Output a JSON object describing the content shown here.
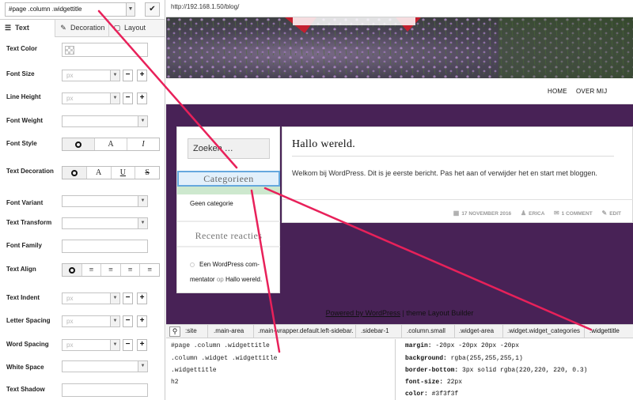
{
  "selector": {
    "value": "#page .column .widgettitle",
    "confirm": "✔"
  },
  "tabs": {
    "text": "Text",
    "decoration": "Decoration",
    "layout": "Layout"
  },
  "props": {
    "text_color": "Text Color",
    "font_size": "Font Size",
    "line_height": "Line Height",
    "font_weight": "Font Weight",
    "font_style": "Font Style",
    "text_decoration": "Text Decoration",
    "font_variant": "Font Variant",
    "text_transform": "Text Transform",
    "font_family": "Font Family",
    "text_align": "Text Align",
    "text_indent": "Text Indent",
    "letter_spacing": "Letter Spacing",
    "word_spacing": "Word Spacing",
    "white_space": "White Space",
    "text_shadow": "Text Shadow"
  },
  "unit_placeholder": "px",
  "stepper": {
    "minus": "−",
    "plus": "+"
  },
  "font_style_options": [
    "A",
    "I"
  ],
  "text_decoration_options": [
    "A",
    "U",
    "S"
  ],
  "browser": {
    "url": "http://192.168.1.50/blog/"
  },
  "nav": {
    "home": "HOME",
    "about": "OVER MIJ"
  },
  "sidebar": {
    "search_placeholder": "Zoeken …",
    "categories_title": "Categorieen",
    "categories_item": "Geen categorie",
    "recent_title": "Recente reacties",
    "recent_author_1": "Een WordPress com-",
    "recent_author_2": "mentator",
    "recent_on": "op",
    "recent_post": "Hallo wereld."
  },
  "post": {
    "title": "Hallo wereld.",
    "body": "Welkom bij WordPress. Dit is je eerste bericht. Pas het aan of verwijder het en start met bloggen.",
    "date": "17 NOVEMBER 2016",
    "author": "ERICA",
    "comments": "1 COMMENT",
    "edit": "EDIT"
  },
  "footer": {
    "link": "Powered by WordPress",
    "sep": " | ",
    "theme": "theme  Layout Builder"
  },
  "breadcrumbs": [
    ":site",
    ".main-area",
    ".main-wrapper.default.left-sidebar.",
    ".sidebar-1",
    ".column.small",
    ".widget-area",
    ".widget.widget_categories",
    ".widgettitle"
  ],
  "selectors": [
    "#page .column .widgettitle",
    ".column .widget .widgettitle",
    ".widgettitle",
    "h2"
  ],
  "css": [
    {
      "prop": "margin:",
      "value": " -20px -20px 20px -20px"
    },
    {
      "prop": "background:",
      "value": " rgba(255,255,255,1)"
    },
    {
      "prop": "border-bottom:",
      "value": " 3px solid rgba(220,220, 220, 0.3)"
    },
    {
      "prop": "font-size:",
      "value": " 22px"
    },
    {
      "prop": "color:",
      "value": " #3f3f3f"
    }
  ],
  "colors": {
    "annotation": "#e8215a",
    "content_bg": "#482256",
    "highlight": "#65a8de"
  }
}
